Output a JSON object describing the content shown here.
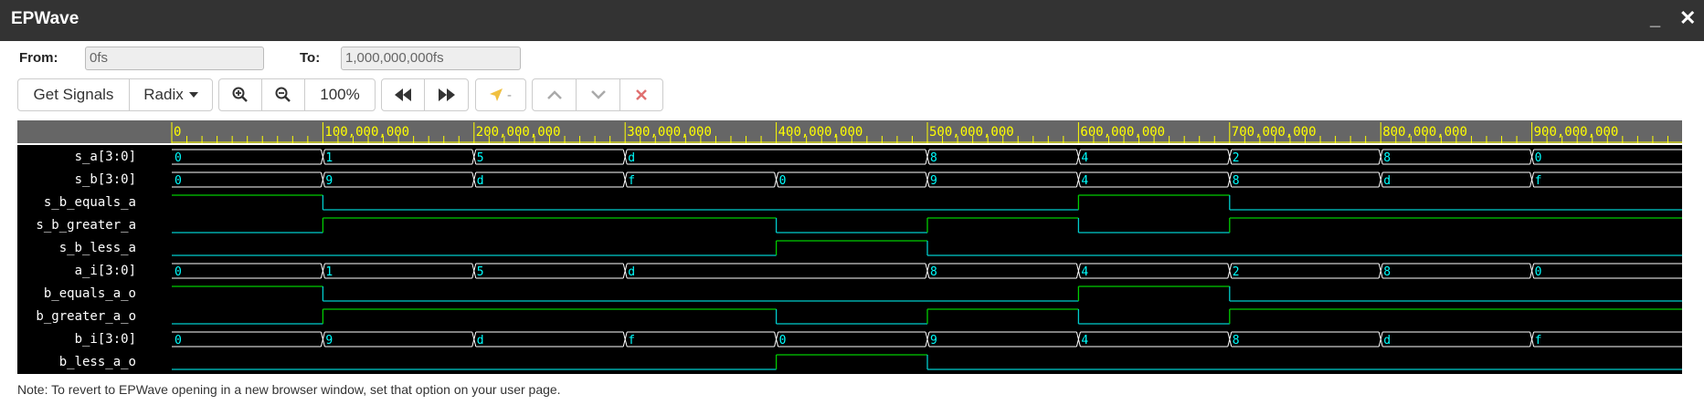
{
  "window": {
    "title": "EPWave",
    "minimize": "_",
    "close": "✕"
  },
  "range": {
    "from_label": "From:",
    "from_value": "0fs",
    "to_label": "To:",
    "to_value": "1,000,000,000fs"
  },
  "toolbar": {
    "get_signals": "Get Signals",
    "radix": "Radix",
    "zoom_in_icon": "zoom-in-icon",
    "zoom_out_icon": "zoom-out-icon",
    "zoom_level": "100%",
    "prev_edge_icon": "rewind-icon",
    "next_edge_icon": "fast-forward-icon",
    "cursor_icon": "cursor-arrow-icon",
    "cursor_value": "-",
    "move_up_icon": "chevron-up-icon",
    "move_down_icon": "chevron-down-icon",
    "delete_icon": "delete-x-icon"
  },
  "colors": {
    "background": "#000000",
    "ruler_bg": "#ffffff",
    "ruler_text": "#ffff00",
    "bus": "#ffffff",
    "bus_text": "#00ffff",
    "signal_high": "#00cc00",
    "signal_low": "#00cccc",
    "header_bg": "#666666"
  },
  "timeline": {
    "ticks": [
      "0",
      "100,000,000",
      "200,000,000",
      "300,000,000",
      "400,000,000",
      "500,000,000",
      "600,000,000",
      "700,000,000",
      "800,000,000",
      "900,000,000"
    ],
    "tick_values": [
      0,
      100000000,
      200000000,
      300000000,
      400000000,
      500000000,
      600000000,
      700000000,
      800000000,
      900000000
    ],
    "range_fs": [
      0,
      1000000000
    ]
  },
  "signals": [
    {
      "name": "s_a[3:0]",
      "type": "bus",
      "changes": [
        [
          0,
          "0"
        ],
        [
          100000000,
          "1"
        ],
        [
          200000000,
          "5"
        ],
        [
          300000000,
          "d"
        ],
        [
          500000000,
          "8"
        ],
        [
          600000000,
          "4"
        ],
        [
          700000000,
          "2"
        ],
        [
          800000000,
          "8"
        ],
        [
          900000000,
          "0"
        ]
      ]
    },
    {
      "name": "s_b[3:0]",
      "type": "bus",
      "changes": [
        [
          0,
          "0"
        ],
        [
          100000000,
          "9"
        ],
        [
          200000000,
          "d"
        ],
        [
          300000000,
          "f"
        ],
        [
          400000000,
          "0"
        ],
        [
          500000000,
          "9"
        ],
        [
          600000000,
          "4"
        ],
        [
          700000000,
          "8"
        ],
        [
          800000000,
          "d"
        ],
        [
          900000000,
          "f"
        ]
      ]
    },
    {
      "name": "s_b_equals_a",
      "type": "bit",
      "changes": [
        [
          0,
          1
        ],
        [
          100000000,
          0
        ],
        [
          600000000,
          1
        ],
        [
          700000000,
          0
        ]
      ]
    },
    {
      "name": "s_b_greater_a",
      "type": "bit",
      "changes": [
        [
          0,
          0
        ],
        [
          100000000,
          1
        ],
        [
          400000000,
          0
        ],
        [
          500000000,
          1
        ],
        [
          600000000,
          0
        ],
        [
          700000000,
          1
        ]
      ]
    },
    {
      "name": "s_b_less_a",
      "type": "bit",
      "changes": [
        [
          0,
          0
        ],
        [
          400000000,
          1
        ],
        [
          500000000,
          0
        ]
      ]
    },
    {
      "name": "a_i[3:0]",
      "type": "bus",
      "changes": [
        [
          0,
          "0"
        ],
        [
          100000000,
          "1"
        ],
        [
          200000000,
          "5"
        ],
        [
          300000000,
          "d"
        ],
        [
          500000000,
          "8"
        ],
        [
          600000000,
          "4"
        ],
        [
          700000000,
          "2"
        ],
        [
          800000000,
          "8"
        ],
        [
          900000000,
          "0"
        ]
      ]
    },
    {
      "name": "b_equals_a_o",
      "type": "bit",
      "changes": [
        [
          0,
          1
        ],
        [
          100000000,
          0
        ],
        [
          600000000,
          1
        ],
        [
          700000000,
          0
        ]
      ]
    },
    {
      "name": "b_greater_a_o",
      "type": "bit",
      "changes": [
        [
          0,
          0
        ],
        [
          100000000,
          1
        ],
        [
          400000000,
          0
        ],
        [
          500000000,
          1
        ],
        [
          600000000,
          0
        ],
        [
          700000000,
          1
        ]
      ]
    },
    {
      "name": "b_i[3:0]",
      "type": "bus",
      "changes": [
        [
          0,
          "0"
        ],
        [
          100000000,
          "9"
        ],
        [
          200000000,
          "d"
        ],
        [
          300000000,
          "f"
        ],
        [
          400000000,
          "0"
        ],
        [
          500000000,
          "9"
        ],
        [
          600000000,
          "4"
        ],
        [
          700000000,
          "8"
        ],
        [
          800000000,
          "d"
        ],
        [
          900000000,
          "f"
        ]
      ]
    },
    {
      "name": "b_less_a_o",
      "type": "bit",
      "changes": [
        [
          0,
          0
        ],
        [
          400000000,
          1
        ],
        [
          500000000,
          0
        ]
      ]
    }
  ],
  "footer": {
    "note": "Note: To revert to EPWave opening in a new browser window, set that option on your user page."
  }
}
